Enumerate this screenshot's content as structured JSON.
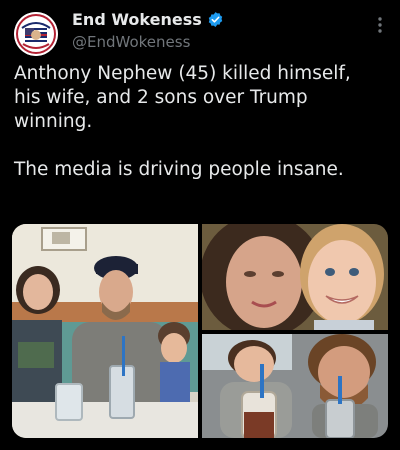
{
  "author": {
    "display_name": "End Wokeness",
    "handle": "@EndWokeness",
    "avatar_icon": "flag-badge-avatar",
    "verified_icon": "verified-badge-icon",
    "verified_color": "#1d9bf0"
  },
  "menu": {
    "icon": "more-vertical-icon"
  },
  "post": {
    "lines": [
      "Anthony Nephew (45) killed himself,",
      "his wife, and 2 sons over Trump",
      "winning."
    ],
    "lines2": [
      "The media is driving people insane."
    ]
  },
  "media": {
    "photos": [
      {
        "description_icon": "family-photo-restaurant"
      },
      {
        "description_icon": "mother-son-selfie"
      },
      {
        "description_icon": "father-son-milkshakes"
      }
    ]
  },
  "colors": {
    "background": "#000000",
    "text": "#e7e9ea",
    "secondary_text": "#71767b",
    "accent": "#1d9bf0"
  }
}
